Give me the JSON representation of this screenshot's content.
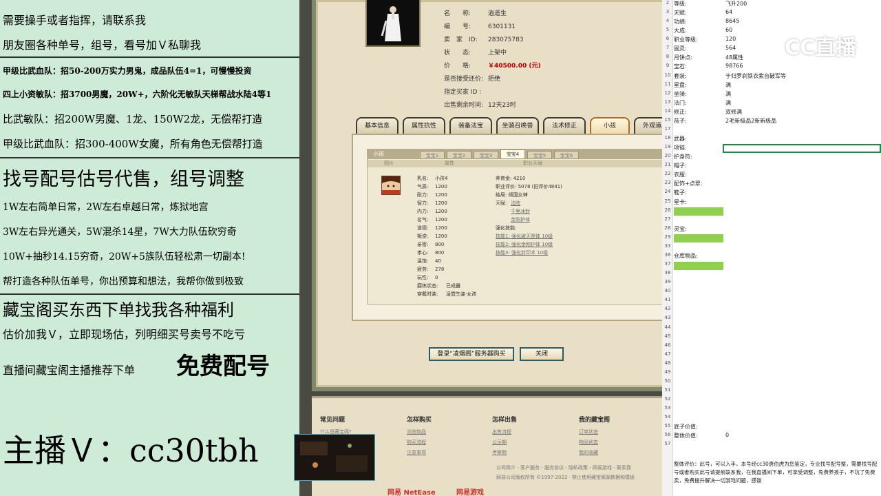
{
  "left_panel": {
    "lines": [
      "需要操手或者指挥，请联系我",
      "朋友圈各种单号，组号，看号加Ｖ私聊我",
      "甲级比武血队：招50-200万实力男鬼，成品队伍4=1，可慢慢投资",
      "四上小资敏队：招3700男魔，20W+，六阶化无敏队天梯帮战水陆4等1",
      "比武敏队：招200W男魔、1龙、150W2龙，无偿帮打造",
      "甲级比武血队：招300-400W女魔，所有角色无偿帮打造",
      "找号配号估号代售，组号调整",
      "1W左右简单日常，2W左右卓越日常，炼狱地宫",
      "3W左右异光通关，5W混杀14星，7W大力队伍砍穷奇",
      "10W+抽秒14.15穷奇，20W+5族队伍轻松肃一切副本!",
      "帮打造各种队伍单号，你出预算和想法，我帮你做到极致",
      "藏宝阁买东西下单找我各种福利",
      "估价加我Ｖ，立即现场估，列明细买号卖号不吃亏",
      "直播间藏宝阁主播推荐下单",
      "免费配号",
      "主播Ｖ：cc30tbh"
    ]
  },
  "game": {
    "info": {
      "name_label": "名　　称:",
      "name_value": "逍遥生",
      "id_label": "编　　号:",
      "id_value": "6301131",
      "seller_label": "卖　家　ID:",
      "seller_value": "283075783",
      "status_label": "状　　态:",
      "status_value": "上架中",
      "price_label": "价　　格:",
      "price_value": "￥40500.00 (元)",
      "bargain_label": "是否接受还价:",
      "bargain_value": "拒绝",
      "buyer_label": "指定买家 ID :",
      "buyer_value": "",
      "time_label": "出售剩余时间:",
      "time_value": "12天23时"
    },
    "tabs": [
      "基本信息",
      "属性抗性",
      "装备法宝",
      "坐骑召唤兽",
      "法术修正",
      "小孩",
      "外观道具"
    ],
    "child": {
      "header": "小孩",
      "subtabs": [
        "宝宝1",
        "宝宝2",
        "宝宝3",
        "宝宝4",
        "宝宝5",
        "宝宝6"
      ],
      "subhead_image": "图片",
      "subhead_attr": "属性",
      "subhead_skill": "职业天赋",
      "stats": [
        {
          "k": "乳名:",
          "v": "小孩4"
        },
        {
          "k": "气质:",
          "v": "1200"
        },
        {
          "k": "耐力:",
          "v": "1200"
        },
        {
          "k": "智力:",
          "v": "1200"
        },
        {
          "k": "内力:",
          "v": "1200"
        },
        {
          "k": "名气:",
          "v": "1200"
        },
        {
          "k": "道德:",
          "v": "1200"
        },
        {
          "k": "叛逆:",
          "v": "1200"
        },
        {
          "k": "亲密:",
          "v": "800"
        },
        {
          "k": "孝心:",
          "v": "800"
        },
        {
          "k": "温饱:",
          "v": "40"
        },
        {
          "k": "疲劳:",
          "v": "278"
        },
        {
          "k": "玩性:",
          "v": "0"
        },
        {
          "k": "磨练状态:",
          "v": "已成器"
        },
        {
          "k": "穿戴时装:",
          "v": "凌霓生姿·女孩"
        }
      ],
      "right": {
        "fund": "养育金: 4210",
        "score": "职业评价: 5078 (旧评价4841)",
        "ending": "结局: 倾国女神",
        "talent_label": "天赋:",
        "talents": [
          "法阵",
          "千里冰封",
          "金刚护体"
        ],
        "skill_label": "强化技能:",
        "skills": [
          "技能1: 强化破天罡体 10级",
          "技能2: 强化金刚护体 10级",
          "技能3: 强化封印术 10级"
        ]
      }
    },
    "buttons": {
      "buy": "登录“凌烟阁”服务器购买",
      "close": "关闭"
    },
    "footer": {
      "sections": [
        {
          "title": "常见问题",
          "links": [
            "什么是藏宝阁?",
            "",
            ""
          ]
        },
        {
          "title": "怎样购买",
          "links": [
            "浏览物品",
            "购买流程",
            "注意事项"
          ]
        },
        {
          "title": "怎样出售",
          "links": [
            "出售流程",
            "公示期",
            "考察期"
          ]
        },
        {
          "title": "我的藏宝阁",
          "links": [
            "订单状态",
            "物品状态",
            "我的收藏"
          ]
        }
      ],
      "company_links": "公司简介 - 客户服务 - 服务协议 - 隐私政策 - 网易游戏 - 联系我",
      "copyright": "网易公司版权所有 ©1997-2022 · 禁止使用藏宝阁源数据和模板",
      "logos": [
        "网易 NetEase",
        "网易游戏"
      ]
    }
  },
  "sheet": {
    "rows": [
      {
        "n": "2",
        "a": "等级:",
        "b": "飞升200"
      },
      {
        "n": "3",
        "a": "天赋:",
        "b": "64"
      },
      {
        "n": "4",
        "a": "功绩:",
        "b": "8645"
      },
      {
        "n": "5",
        "a": "大成:",
        "b": "60"
      },
      {
        "n": "6",
        "a": "职业等级:",
        "b": "120"
      },
      {
        "n": "7",
        "a": "固灵:",
        "b": "564"
      },
      {
        "n": "8",
        "a": "月饼点:",
        "b": "48属性"
      },
      {
        "n": "9",
        "a": "宝石:",
        "b": "98766"
      },
      {
        "n": "10",
        "a": "套装:",
        "b": "于归罗刹铁衣紫台破军等"
      },
      {
        "n": "11",
        "a": "星盘:",
        "b": "满"
      },
      {
        "n": "12",
        "a": "坐骑:",
        "b": "满"
      },
      {
        "n": "13",
        "a": "法门:",
        "b": "满"
      },
      {
        "n": "14",
        "a": "修正:",
        "b": "双修满"
      },
      {
        "n": "15",
        "a": "孩子:",
        "b": "2毛新极品2新新极品"
      },
      {
        "n": "17",
        "a": "",
        "b": ""
      },
      {
        "n": "18",
        "a": "武器:",
        "b": ""
      },
      {
        "n": "19",
        "a": "项链:",
        "b": ""
      },
      {
        "n": "20",
        "a": "护身符:",
        "b": ""
      },
      {
        "n": "21",
        "a": "帽子:",
        "b": ""
      },
      {
        "n": "22",
        "a": "衣服:",
        "b": ""
      },
      {
        "n": "23",
        "a": "配饰+点翠:",
        "b": ""
      },
      {
        "n": "24",
        "a": "鞋子:",
        "b": ""
      },
      {
        "n": "25",
        "a": "星卡:",
        "b": ""
      },
      {
        "n": "26",
        "a": "",
        "b": ""
      },
      {
        "n": "27",
        "a": "",
        "b": ""
      },
      {
        "n": "28",
        "a": "灵宝:",
        "b": ""
      },
      {
        "n": "29",
        "a": "",
        "b": ""
      },
      {
        "n": "33",
        "a": "",
        "b": ""
      },
      {
        "n": "36",
        "a": "仓库物品:",
        "b": ""
      },
      {
        "n": "37",
        "a": "",
        "b": ""
      },
      {
        "n": "38",
        "a": "",
        "b": ""
      },
      {
        "n": "39",
        "a": "",
        "b": ""
      },
      {
        "n": "40",
        "a": "",
        "b": ""
      },
      {
        "n": "41",
        "a": "",
        "b": ""
      },
      {
        "n": "42",
        "a": "",
        "b": ""
      },
      {
        "n": "43",
        "a": "",
        "b": ""
      },
      {
        "n": "44",
        "a": "",
        "b": ""
      },
      {
        "n": "45",
        "a": "",
        "b": ""
      },
      {
        "n": "46",
        "a": "",
        "b": ""
      },
      {
        "n": "47",
        "a": "",
        "b": ""
      },
      {
        "n": "48",
        "a": "",
        "b": ""
      },
      {
        "n": "49",
        "a": "",
        "b": ""
      },
      {
        "n": "50",
        "a": "",
        "b": ""
      },
      {
        "n": "51",
        "a": "",
        "b": ""
      },
      {
        "n": "52",
        "a": "",
        "b": ""
      },
      {
        "n": "53",
        "a": "",
        "b": ""
      },
      {
        "n": "54",
        "a": "",
        "b": ""
      },
      {
        "n": "55",
        "a": "底子价值:",
        "b": ""
      },
      {
        "n": "56",
        "a": "整体价值:",
        "b": "0"
      },
      {
        "n": "57",
        "a": "",
        "b": ""
      }
    ],
    "highlight_color": "#8fd14f",
    "note": "整体评价：此号，可以入手，本号经cc30唐伯虎为您鉴定，专业找号配号整，需要找号配号或者购买此号请提前联系我，在我直播间下单，可享受调整，免费养孩子，不坑了免费卖，免费提升解决一切游戏问题，感谢"
  },
  "watermark": "CC直播",
  "colors": {
    "left_bg": "#cdebd6",
    "price_red": "#c00000",
    "sheet_highlight": "#8fd14f"
  }
}
